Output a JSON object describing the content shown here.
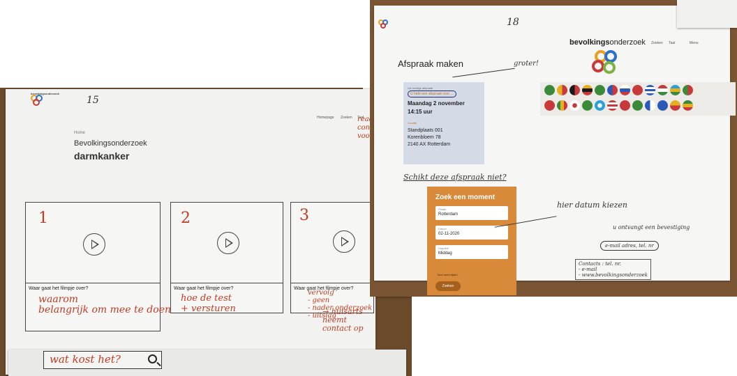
{
  "left_sheet": {
    "page_number": "15",
    "nav": [
      "Homepage",
      "Zoeken",
      "Taal"
    ],
    "breadcrumb": "Home",
    "title_line1": "Bevolkingsonderzoek",
    "title_line2": "darmkanker",
    "margin_note": "reac\ncontr\nvoor",
    "cards": [
      {
        "number": "1",
        "question": "Waar gaat het filmpje over?",
        "note": "waarom\nbelangrijk om mee te doen"
      },
      {
        "number": "2",
        "question": "Waar gaat het filmpje over?",
        "note": "hoe de test\n+ versturen"
      },
      {
        "number": "3",
        "question": "Waar gaat het filmpje over?",
        "note": "vervolg\n- geen\n- nader onderzoek\n- uitslag"
      }
    ],
    "right_note": "→ huisarts\nneemt\ncontact op",
    "search_note": "wat kost het?"
  },
  "right_sheet": {
    "page_number": "18",
    "brand_bold": "bevolkings",
    "brand_rest": "onderzoek",
    "nav": [
      "Zoeken",
      "Taal",
      "Menu"
    ],
    "heading": "Afspraak maken",
    "heading_note": "groter!",
    "appointment": {
      "pre": "Uw huidige afspraak",
      "highlight": "U hebt een afspraak voor ...",
      "date": "Maandag 2 november",
      "time": "14:15 uur",
      "location_label": "Locatie",
      "location_lines": [
        "Standplaats 001",
        "Korenbloem 78",
        "2140 AX Rotterdam"
      ]
    },
    "question_note": "Schikt deze afspraak niet?",
    "form": {
      "title": "Zoek een moment",
      "fields": [
        {
          "label": "Plaats",
          "value": "Rotterdam"
        },
        {
          "label": "Datum",
          "value": "02-11-2020"
        },
        {
          "label": "Dagdeel",
          "value": "Middag"
        }
      ],
      "checkbox": "Toon meer tijden",
      "button": "Zoeken"
    },
    "notes": {
      "date_pick": "hier datum kiezen",
      "confirm": "u ontvangt een bevestiging",
      "contact": "e-mail adres, tel. nr",
      "contacts": "Contacts : tel. nr.\n- e-mail\n- www.bevolkingsonderzoek"
    }
  }
}
